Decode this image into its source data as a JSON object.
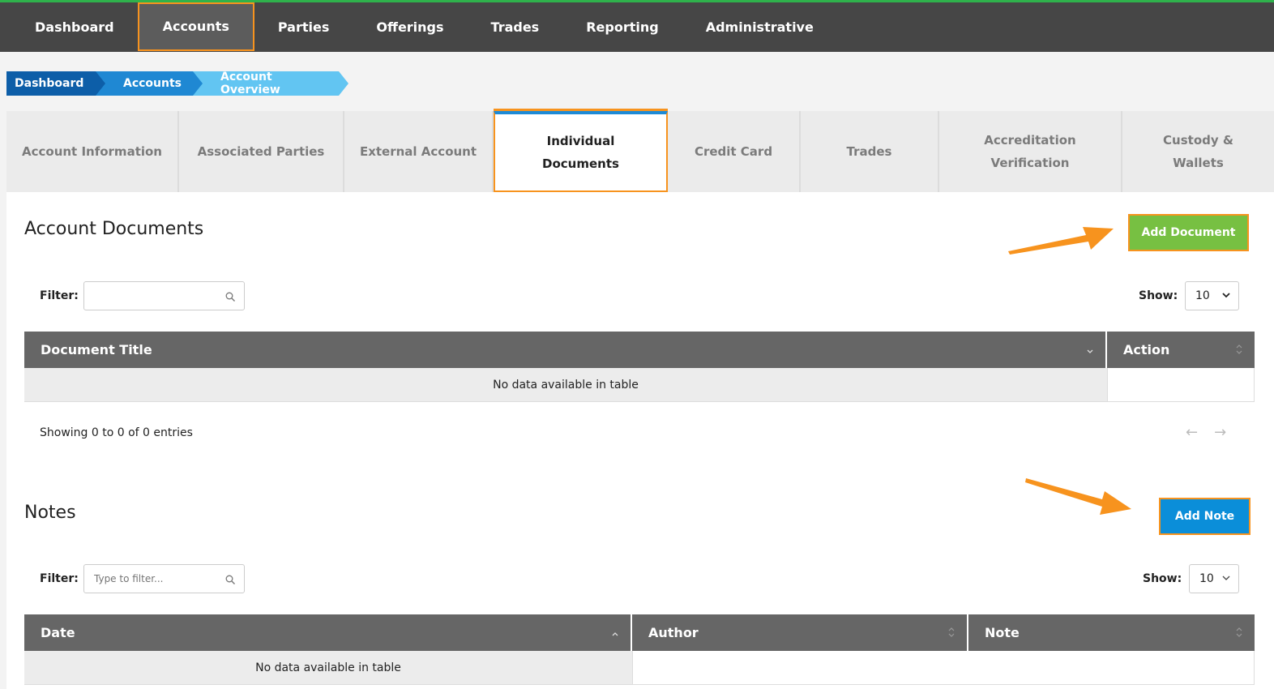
{
  "nav": {
    "items": [
      "Dashboard",
      "Accounts",
      "Parties",
      "Offerings",
      "Trades",
      "Reporting",
      "Administrative"
    ]
  },
  "breadcrumb": [
    "Dashboard",
    "Accounts",
    "Account Overview"
  ],
  "tabs": [
    {
      "line1": "Account Information",
      "line2": ""
    },
    {
      "line1": "Associated Parties",
      "line2": ""
    },
    {
      "line1": "External Account",
      "line2": ""
    },
    {
      "line1": "Individual",
      "line2": "Documents"
    },
    {
      "line1": "Credit Card",
      "line2": ""
    },
    {
      "line1": "Trades",
      "line2": ""
    },
    {
      "line1": "Accreditation",
      "line2": "Verification"
    },
    {
      "line1": "Custody &",
      "line2": "Wallets"
    }
  ],
  "documents": {
    "title": "Account Documents",
    "add_label": "Add Document",
    "filter_label": "Filter:",
    "filter_placeholder": "",
    "show_label": "Show:",
    "show_value": "10",
    "columns": [
      "Document Title",
      "Action"
    ],
    "empty_text": "No data available in table",
    "showing_text": "Showing 0 to 0 of 0 entries",
    "prev_arrow": "←",
    "next_arrow": "→"
  },
  "notes": {
    "title": "Notes",
    "add_label": "Add Note",
    "filter_label": "Filter:",
    "filter_placeholder": "Type to filter...",
    "show_label": "Show:",
    "show_value": "10",
    "columns": [
      "Date",
      "Author",
      "Note"
    ],
    "empty_text": "No data available in table"
  },
  "colors": {
    "nav_bg": "#464646",
    "accent_top": "#2fb24c",
    "highlight": "#f7931e",
    "green_button": "#77c042",
    "blue_button": "#0b8ed9"
  }
}
